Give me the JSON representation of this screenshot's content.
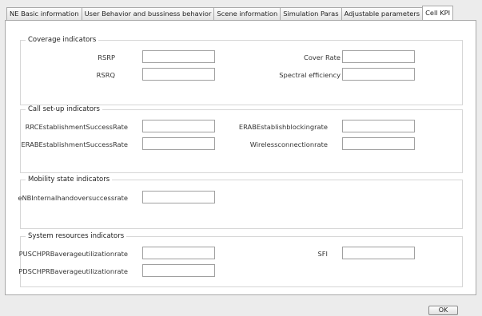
{
  "tabs": [
    {
      "label": "NE Basic information",
      "active": false
    },
    {
      "label": "User Behavior and bussiness behavior",
      "active": false
    },
    {
      "label": "Scene information",
      "active": false
    },
    {
      "label": "Simulation Paras",
      "active": false
    },
    {
      "label": "Adjustable parameters",
      "active": false
    },
    {
      "label": "Cell KPI",
      "active": true
    }
  ],
  "groups": {
    "coverage": {
      "title": "Coverage indicators",
      "rsrp": {
        "label": "RSRP",
        "value": ""
      },
      "cover_rate": {
        "label": "Cover Rate",
        "value": ""
      },
      "rsrq": {
        "label": "RSRQ",
        "value": ""
      },
      "spectral_efficiency": {
        "label": "Spectral efficiency",
        "value": ""
      }
    },
    "call_setup": {
      "title": "Call set-up indicators",
      "rrc_success": {
        "label": "RRCEstablishmentSuccessRate",
        "value": ""
      },
      "erab_blocking": {
        "label": "ERABEstablishblockingrate",
        "value": ""
      },
      "erab_success": {
        "label": "ERABEstablishmentSuccessRate",
        "value": ""
      },
      "wireless_connection": {
        "label": "Wirelessconnectionrate",
        "value": ""
      }
    },
    "mobility": {
      "title": "Mobility state indicators",
      "enb_handover": {
        "label": "eNBInternalhandoversuccessrate",
        "value": ""
      }
    },
    "system_resources": {
      "title": "System resources indicators",
      "pusch_prb": {
        "label": "PUSCHPRBaverageutilizationrate",
        "value": ""
      },
      "sfi": {
        "label": "SFI",
        "value": ""
      },
      "pdsch_prb": {
        "label": "PDSCHPRBaverageutilizationrate",
        "value": ""
      }
    }
  },
  "buttons": {
    "ok_label": "OK"
  }
}
